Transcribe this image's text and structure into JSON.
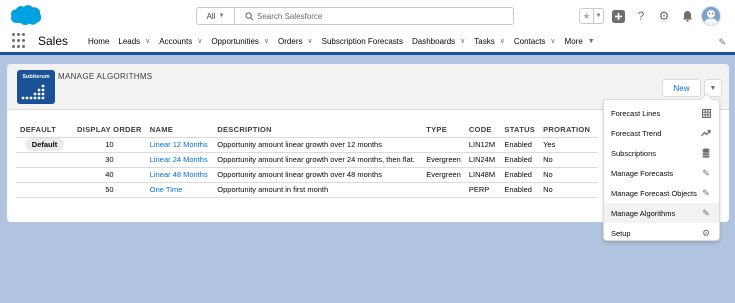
{
  "header": {
    "search_scope": "All",
    "search_placeholder": "Search Salesforce"
  },
  "nav": {
    "app_name": "Sales",
    "items": [
      {
        "label": "Home",
        "has_menu": false
      },
      {
        "label": "Leads",
        "has_menu": true
      },
      {
        "label": "Accounts",
        "has_menu": true
      },
      {
        "label": "Opportunities",
        "has_menu": true
      },
      {
        "label": "Orders",
        "has_menu": true
      },
      {
        "label": "Subscription Forecasts",
        "has_menu": false
      },
      {
        "label": "Dashboards",
        "has_menu": true
      },
      {
        "label": "Tasks",
        "has_menu": true
      },
      {
        "label": "Contacts",
        "has_menu": true
      },
      {
        "label": "More",
        "has_menu": true
      }
    ]
  },
  "brand": {
    "word": "Subiterum"
  },
  "page": {
    "title": "MANAGE ALGORITHMS",
    "new_button": "New"
  },
  "table": {
    "columns": [
      "DEFAULT",
      "DISPLAY ORDER",
      "NAME",
      "DESCRIPTION",
      "TYPE",
      "CODE",
      "STATUS",
      "PRORATION"
    ],
    "default_badge": "Default",
    "rows": [
      {
        "is_default": true,
        "order": "10",
        "name": "Linear 12 Months",
        "description": "Opportunity amount linear growth over 12 months",
        "type": "",
        "code": "LIN12M",
        "status": "Enabled",
        "proration": "Yes"
      },
      {
        "is_default": false,
        "order": "30",
        "name": "Linear 24 Months",
        "description": "Opportunity amount linear growth over 24 months, then flat.",
        "type": "Evergreen",
        "code": "LIN24M",
        "status": "Enabled",
        "proration": "No"
      },
      {
        "is_default": false,
        "order": "40",
        "name": "Linear 48 Months",
        "description": "Opportunity amount linear growth over 48 months",
        "type": "Evergreen",
        "code": "LIN48M",
        "status": "Enabled",
        "proration": "No"
      },
      {
        "is_default": false,
        "order": "50",
        "name": "One Time",
        "description": "Opportunity amount in first month",
        "type": "",
        "code": "PERP",
        "status": "Enabled",
        "proration": "No"
      }
    ]
  },
  "menu": {
    "items": [
      {
        "label": "Forecast Lines",
        "icon": "table-icon"
      },
      {
        "label": "Forecast Trend",
        "icon": "trend-icon"
      },
      {
        "label": "Subscriptions",
        "icon": "database-icon"
      },
      {
        "label": "Manage Forecasts",
        "icon": "edit-icon"
      },
      {
        "label": "Manage Forecast Objects",
        "icon": "edit-icon"
      },
      {
        "label": "Manage Algorithms",
        "icon": "edit-icon",
        "active": true
      },
      {
        "label": "Setup",
        "icon": "gear-icon"
      }
    ]
  },
  "colors": {
    "brand_blue": "#1b5297",
    "link": "#0070d2",
    "background": "#b0c4df"
  }
}
